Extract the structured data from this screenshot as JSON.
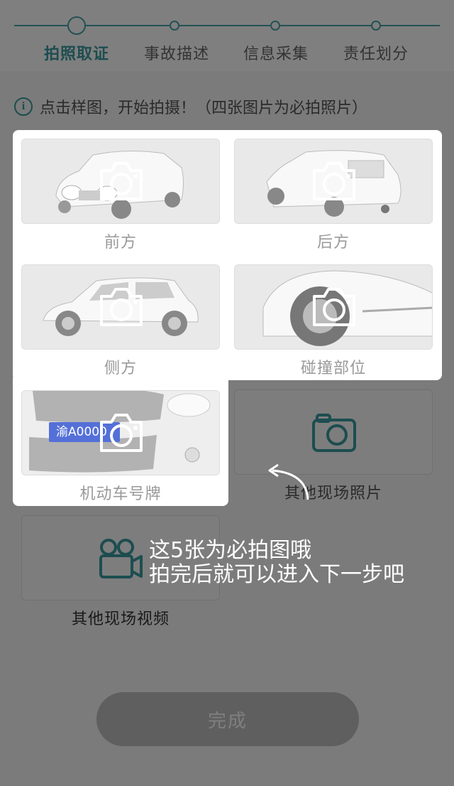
{
  "steps": [
    {
      "label": "拍照取证",
      "active": true
    },
    {
      "label": "事故描述",
      "active": false
    },
    {
      "label": "信息采集",
      "active": false
    },
    {
      "label": "责任划分",
      "active": false
    }
  ],
  "hint": {
    "icon": "info-icon",
    "text": "点击样图，开始拍摄！（四张图片为必拍照片）"
  },
  "photos": [
    {
      "label": "前方",
      "required": true
    },
    {
      "label": "后方",
      "required": true
    },
    {
      "label": "侧方",
      "required": true
    },
    {
      "label": "碰撞部位",
      "required": true
    },
    {
      "label": "机动车号牌",
      "required": true,
      "plate_text": "渝A0000"
    },
    {
      "label": "其他现场照片",
      "required": false
    },
    {
      "label": "其他现场视频",
      "required": false
    }
  ],
  "guide": {
    "line1": "这5张为必拍图哦",
    "line2": "拍完后就可以进入下一步吧"
  },
  "finish_label": "完成",
  "colors": {
    "accent": "#3a9aa1",
    "plate": "#5470d8",
    "overlay": "rgba(0,0,0,0.5)"
  }
}
